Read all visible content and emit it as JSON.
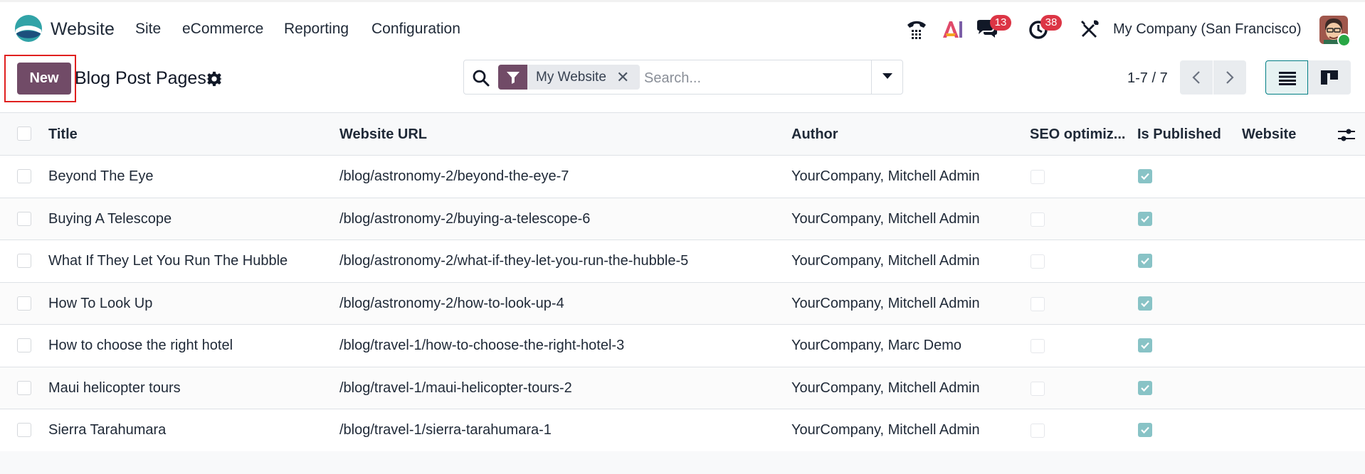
{
  "app": {
    "name": "Website",
    "menu": [
      "Site",
      "eCommerce",
      "Reporting",
      "Configuration"
    ],
    "company": "My Company (San Francisco)",
    "notifications": {
      "messages": "13",
      "activities": "38"
    },
    "icons": {
      "logo": "odoo-website-logo",
      "phone": "phone-icon",
      "ai": "ai-icon",
      "messages": "chat-icon",
      "activities": "clock-icon",
      "tools": "tools-icon"
    },
    "colors": {
      "brand": "#714b67",
      "accent": "#017e84",
      "badge": "#dc3545",
      "published_check": "#88c3c6"
    }
  },
  "control": {
    "new_label": "New",
    "page_title": "Blog Post Pages",
    "search": {
      "facet": "My Website",
      "placeholder": "Search..."
    },
    "pager": "1-7 / 7"
  },
  "table": {
    "headers": [
      "Title",
      "Website URL",
      "Author",
      "SEO optimiz...",
      "Is Published",
      "Website"
    ],
    "rows": [
      {
        "title": "Beyond The Eye",
        "url": "/blog/astronomy-2/beyond-the-eye-7",
        "author": "YourCompany, Mitchell Admin",
        "seo": false,
        "published": true,
        "website": ""
      },
      {
        "title": "Buying A Telescope",
        "url": "/blog/astronomy-2/buying-a-telescope-6",
        "author": "YourCompany, Mitchell Admin",
        "seo": false,
        "published": true,
        "website": ""
      },
      {
        "title": "What If They Let You Run The Hubble",
        "url": "/blog/astronomy-2/what-if-they-let-you-run-the-hubble-5",
        "author": "YourCompany, Mitchell Admin",
        "seo": false,
        "published": true,
        "website": ""
      },
      {
        "title": "How To Look Up",
        "url": "/blog/astronomy-2/how-to-look-up-4",
        "author": "YourCompany, Mitchell Admin",
        "seo": false,
        "published": true,
        "website": ""
      },
      {
        "title": "How to choose the right hotel",
        "url": "/blog/travel-1/how-to-choose-the-right-hotel-3",
        "author": "YourCompany, Marc Demo",
        "seo": false,
        "published": true,
        "website": ""
      },
      {
        "title": "Maui helicopter tours",
        "url": "/blog/travel-1/maui-helicopter-tours-2",
        "author": "YourCompany, Mitchell Admin",
        "seo": false,
        "published": true,
        "website": ""
      },
      {
        "title": "Sierra Tarahumara",
        "url": "/blog/travel-1/sierra-tarahumara-1",
        "author": "YourCompany, Mitchell Admin",
        "seo": false,
        "published": true,
        "website": ""
      }
    ]
  }
}
